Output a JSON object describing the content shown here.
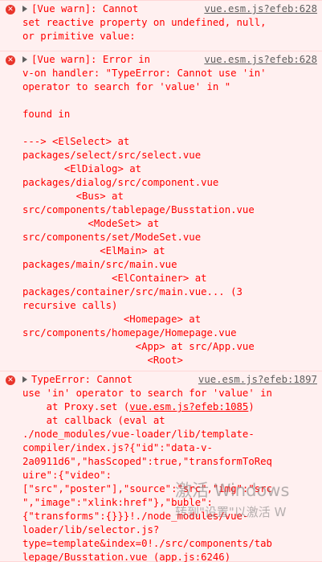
{
  "messages": [
    {
      "summary": "[Vue warn]: Cannot",
      "source": "vue.esm.js?efeb:628",
      "lines": [
        "set reactive property on undefined, null,",
        "or primitive value:"
      ]
    },
    {
      "summary": "[Vue warn]: Error in",
      "source": "vue.esm.js?efeb:628",
      "lines": [
        "v-on handler: \"TypeError: Cannot use 'in'",
        "operator to search for 'value' in \"",
        "",
        "found in",
        "",
        "---> <ElSelect> at",
        "packages/select/src/select.vue",
        "       <ElDialog> at",
        "packages/dialog/src/component.vue",
        "         <Bus> at",
        "src/components/tablepage/Busstation.vue",
        "           <ModeSet> at",
        "src/components/set/ModeSet.vue",
        "             <ElMain> at",
        "packages/main/src/main.vue",
        "               <ElContainer> at",
        "packages/container/src/main.vue... (3",
        "recursive calls)",
        "                 <Homepage> at",
        "src/components/homepage/Homepage.vue",
        "                   <App> at src/App.vue",
        "                     <Root>"
      ]
    },
    {
      "summary": "TypeError: Cannot",
      "source": "vue.esm.js?efeb:1897",
      "lines": [
        "use 'in' operator to search for 'value' in",
        "    at Proxy.set (vue.esm.js?efeb:1085)",
        "    at callback (eval at",
        "./node_modules/vue-loader/lib/template-",
        "compiler/index.js?{\"id\":\"data-v-",
        "2a0911d6\",\"hasScoped\":true,\"transformToReq",
        "uire\":{\"video\":",
        "[\"src\",\"poster\"],\"source\":\"src\",\"img\":\"src",
        "\",\"image\":\"xlink:href\"},\"buble\":",
        "{\"transforms\":{}}}!./node_modules/vue-",
        "loader/lib/selector.js?",
        "type=template&index=0!./src/components/tab",
        "lepage/Busstation.vue (app.js:6246)"
      ],
      "inline_link": "vue.esm.js?efeb:1085"
    }
  ],
  "watermark": {
    "line1": "激活 Windows",
    "line2": "转到\"设置\"以激活 W"
  },
  "colors": {
    "error_text": "#ff0000",
    "error_bg": "#fff0f0",
    "source_link": "#5f5f5f"
  }
}
